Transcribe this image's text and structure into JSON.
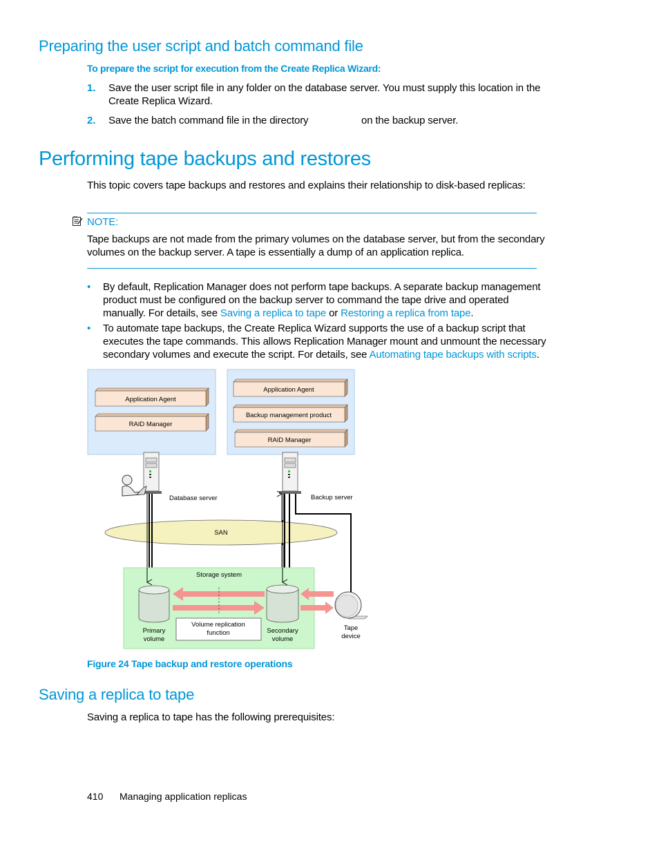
{
  "section1": {
    "heading": "Preparing the user script and batch command file",
    "procedure_title": "To prepare the script for execution from the Create Replica Wizard:",
    "steps": [
      {
        "num": "1.",
        "line1": "Save the user script file in any folder on the database server. You must supply this location in the",
        "line2": "Create Replica Wizard."
      },
      {
        "num": "2.",
        "text_before": "Save the batch command file in the directory",
        "text_after": "on the backup server."
      }
    ]
  },
  "section2": {
    "heading": "Performing tape backups and restores",
    "intro": "This topic covers tape backups and restores and explains their relationship to disk-based replicas:",
    "note": {
      "icon": "note-icon",
      "label": "NOTE:",
      "line1": "Tape backups are not made from the primary volumes on the database server, but from the secondary",
      "line2": "volumes on the backup server. A tape is essentially a dump of an application replica."
    },
    "bullets": [
      {
        "line1": "By default, Replication Manager does not perform tape backups. A separate backup management",
        "line2": "product must be configured on the backup server to command the tape drive and operated",
        "line3_before": "manually. For details, see ",
        "link1": "Saving a replica to tape",
        "mid": " or ",
        "link2": "Restoring a replica from tape",
        "end": "."
      },
      {
        "line1": "To automate tape backups, the Create Replica Wizard supports the use of a backup script that",
        "line2": "executes the tape commands. This allows Replication Manager mount and unmount the necessary",
        "line3_before": "secondary volumes and execute the script. For details, see ",
        "link1": "Automating tape backups with scripts",
        "end": "."
      }
    ]
  },
  "figure": {
    "db_box": {
      "components": [
        "Application Agent",
        "RAID Manager"
      ]
    },
    "backup_box": {
      "components": [
        "Application Agent",
        "Backup management product",
        "RAID Manager"
      ]
    },
    "database_server_label": "Database server",
    "backup_server_label": "Backup server",
    "san_label": "SAN",
    "storage_label": "Storage system",
    "primary_volume_label": [
      "Primary",
      "volume"
    ],
    "secondary_volume_label": [
      "Secondary",
      "volume"
    ],
    "replication_label": [
      "Volume replication",
      "function"
    ],
    "tape_label": [
      "Tape",
      "device"
    ],
    "caption": "Figure 24 Tape backup and restore operations",
    "colors": {
      "server_box_fill": "#dcebfb",
      "server_box_stroke": "#a9cdef",
      "component_fill": "#fbe6d5",
      "component_side": "#c99a73",
      "san_fill": "#f6f2bf",
      "storage_fill": "#ccf7cc",
      "storage_stroke": "#9fe29f",
      "arrow_fill": "#f59490"
    }
  },
  "section3": {
    "heading": "Saving a replica to tape",
    "text": "Saving a replica to tape has the following prerequisites:"
  },
  "footer": {
    "page_number": "410",
    "chapter": "Managing application replicas"
  }
}
